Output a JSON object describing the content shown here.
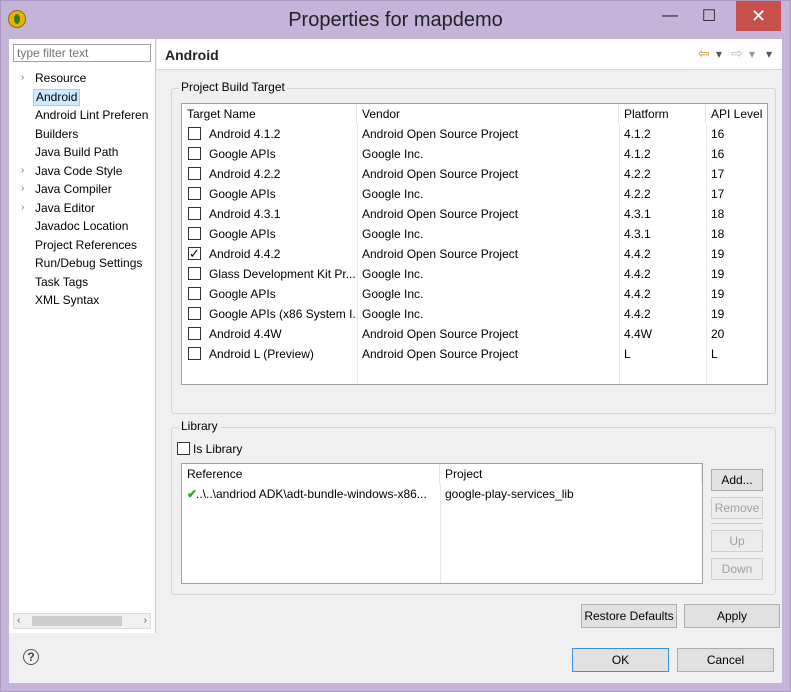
{
  "window": {
    "title": "Properties for mapdemo",
    "minimize": "—",
    "maximize": "☐",
    "close": "✕"
  },
  "left_pane": {
    "filter_placeholder": "type filter text",
    "tree": [
      {
        "label": "Resource",
        "expandable": true,
        "selected": false
      },
      {
        "label": "Android",
        "expandable": false,
        "selected": true
      },
      {
        "label": "Android Lint Preferen",
        "expandable": false,
        "selected": false
      },
      {
        "label": "Builders",
        "expandable": false,
        "selected": false
      },
      {
        "label": "Java Build Path",
        "expandable": false,
        "selected": false
      },
      {
        "label": "Java Code Style",
        "expandable": true,
        "selected": false
      },
      {
        "label": "Java Compiler",
        "expandable": true,
        "selected": false
      },
      {
        "label": "Java Editor",
        "expandable": true,
        "selected": false
      },
      {
        "label": "Javadoc Location",
        "expandable": false,
        "selected": false
      },
      {
        "label": "Project References",
        "expandable": false,
        "selected": false
      },
      {
        "label": "Run/Debug Settings",
        "expandable": false,
        "selected": false
      },
      {
        "label": "Task Tags",
        "expandable": false,
        "selected": false
      },
      {
        "label": "XML Syntax",
        "expandable": false,
        "selected": false
      }
    ],
    "scroll_left": "‹",
    "scroll_right": "›"
  },
  "page": {
    "title": "Android",
    "nav_back": "⇦",
    "nav_back_menu": "▾",
    "nav_fwd": "⇨",
    "nav_fwd_menu": "▾",
    "nav_menu": "▾"
  },
  "build_target": {
    "group_title": "Project Build Target",
    "columns": [
      "Target Name",
      "Vendor",
      "Platform",
      "API Level"
    ],
    "rows": [
      {
        "checked": false,
        "name": "Android 4.1.2",
        "vendor": "Android Open Source Project",
        "platform": "4.1.2",
        "api": "16"
      },
      {
        "checked": false,
        "name": "Google APIs",
        "vendor": "Google Inc.",
        "platform": "4.1.2",
        "api": "16"
      },
      {
        "checked": false,
        "name": "Android 4.2.2",
        "vendor": "Android Open Source Project",
        "platform": "4.2.2",
        "api": "17"
      },
      {
        "checked": false,
        "name": "Google APIs",
        "vendor": "Google Inc.",
        "platform": "4.2.2",
        "api": "17"
      },
      {
        "checked": false,
        "name": "Android 4.3.1",
        "vendor": "Android Open Source Project",
        "platform": "4.3.1",
        "api": "18"
      },
      {
        "checked": false,
        "name": "Google APIs",
        "vendor": "Google Inc.",
        "platform": "4.3.1",
        "api": "18"
      },
      {
        "checked": true,
        "name": "Android 4.4.2",
        "vendor": "Android Open Source Project",
        "platform": "4.4.2",
        "api": "19"
      },
      {
        "checked": false,
        "name": "Glass Development Kit Pr...",
        "vendor": "Google Inc.",
        "platform": "4.4.2",
        "api": "19"
      },
      {
        "checked": false,
        "name": "Google APIs",
        "vendor": "Google Inc.",
        "platform": "4.4.2",
        "api": "19"
      },
      {
        "checked": false,
        "name": "Google APIs (x86 System I...",
        "vendor": "Google Inc.",
        "platform": "4.4.2",
        "api": "19"
      },
      {
        "checked": false,
        "name": "Android 4.4W",
        "vendor": "Android Open Source Project",
        "platform": "4.4W",
        "api": "20"
      },
      {
        "checked": false,
        "name": "Android L (Preview)",
        "vendor": "Android Open Source Project",
        "platform": "L",
        "api": "L"
      }
    ]
  },
  "library": {
    "group_title": "Library",
    "is_library_label": "Is Library",
    "is_library_checked": false,
    "columns": [
      "Reference",
      "Project"
    ],
    "rows": [
      {
        "status": "✔",
        "reference": "..\\..\\andriod ADK\\adt-bundle-windows-x86...",
        "project": "google-play-services_lib"
      }
    ],
    "buttons": {
      "add": "Add...",
      "remove": "Remove",
      "up": "Up",
      "down": "Down"
    }
  },
  "page_buttons": {
    "restore_defaults": "Restore Defaults",
    "apply": "Apply"
  },
  "dialog_buttons": {
    "help": "?",
    "ok": "OK",
    "cancel": "Cancel"
  },
  "colors": {
    "title_bar": "#c6b3d8",
    "close_button": "#c7504c",
    "selection": "#cde8ff",
    "check_green": "#2aa52a"
  }
}
